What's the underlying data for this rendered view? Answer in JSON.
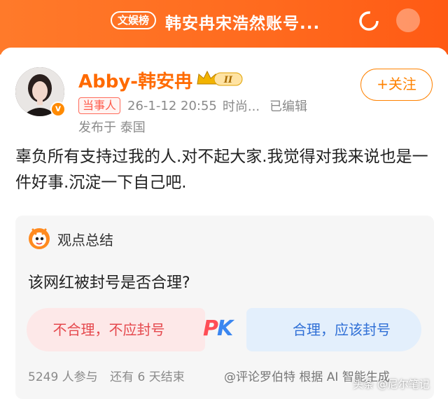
{
  "banner": {
    "badge": "文娱榜",
    "title": "韩安冉宋浩然账号..."
  },
  "profile": {
    "name": "Abby-韩安冉",
    "vip_level": "II",
    "follow_label": "+关注",
    "role_tag": "当事人",
    "timestamp": "26-1-12 20:55",
    "category": "时尚...",
    "edited": "已编辑",
    "location": "发布于 泰国"
  },
  "post": {
    "text": "辜负所有支持过我的人.对不起大家.我觉得对我来说也是一件好事.沉淀一下自己吧."
  },
  "poll": {
    "header": "观点总结",
    "question": "该网红被封号是否合理?",
    "option_left": "不合理，不应封号",
    "option_right": "合理，应该封号",
    "pk_p": "P",
    "pk_k": "K",
    "participants": "5249 人参与",
    "remaining": "还有 6 天结束",
    "source": "@评论罗伯特 根据 AI 智能生成"
  },
  "watermark": "头条 @尼尔笔记",
  "colors": {
    "banner": "#ff6a1e",
    "name": "#ff6a00",
    "follow": "#ff8200",
    "option_left_text": "#e5484d",
    "option_right_text": "#2f6fd6"
  },
  "icons": {
    "refresh": "refresh-icon",
    "more": "more-icon",
    "verified": "verified-icon",
    "crown": "vip-crown-icon",
    "mascot": "mascot-icon"
  }
}
